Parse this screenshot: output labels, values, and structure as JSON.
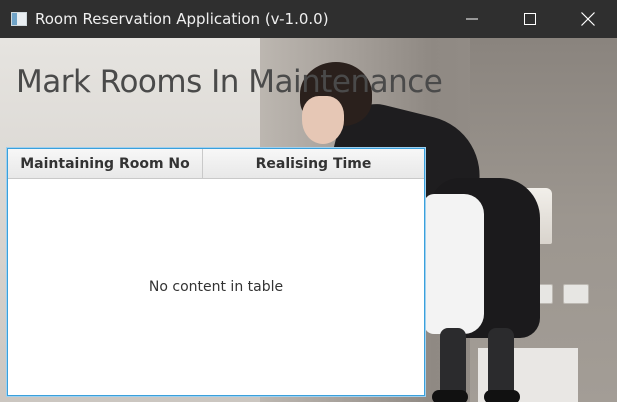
{
  "window": {
    "title": "Room Reservation Application (v-1.0.0)",
    "icon": "app-window-icon"
  },
  "controls": {
    "minimize_icon": "minimize-icon",
    "maximize_icon": "maximize-icon",
    "close_icon": "close-icon"
  },
  "page": {
    "title": "Mark Rooms In Maintenance"
  },
  "table": {
    "columns": [
      "Maintaining Room No",
      "Realising Time"
    ],
    "rows": [],
    "placeholder": "No content in table"
  },
  "colors": {
    "titlebar": "#2f2f2f",
    "table_focus_border": "#3aa0db",
    "heading_text": "#4a4a4a"
  }
}
